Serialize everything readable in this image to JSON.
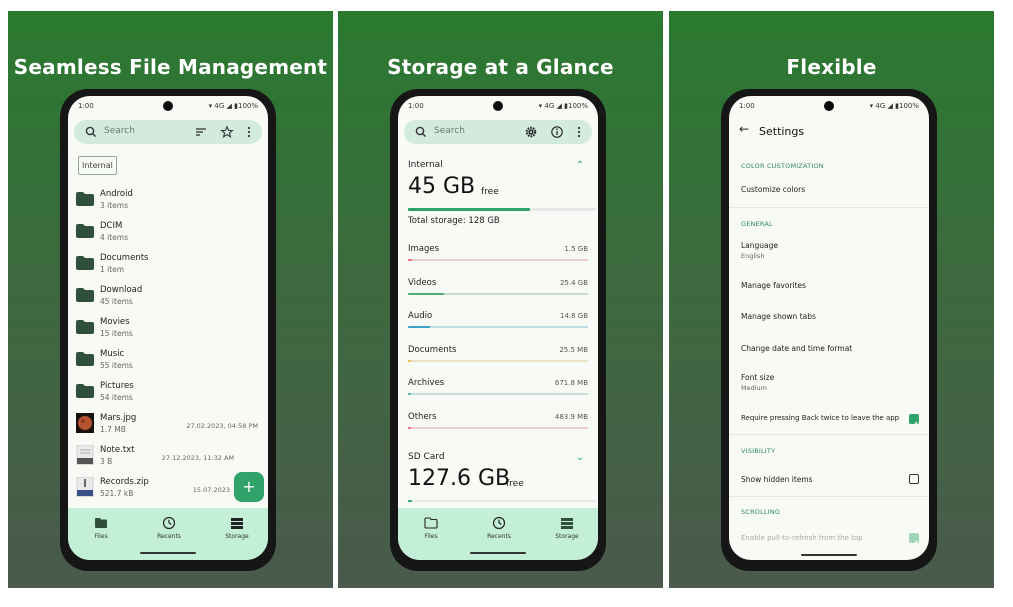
{
  "status": {
    "time": "1:00",
    "battery": "100%",
    "network": "4G"
  },
  "panels": [
    {
      "title": "Seamless File Management"
    },
    {
      "title": "Storage at a Glance"
    },
    {
      "title": "Flexible"
    }
  ],
  "files_screen": {
    "search_placeholder": "Search",
    "location_chip": "Internal",
    "items": [
      {
        "name": "Android",
        "sub": "3 items",
        "date": ""
      },
      {
        "name": "DCIM",
        "sub": "4 items",
        "date": ""
      },
      {
        "name": "Documents",
        "sub": "1 item",
        "date": ""
      },
      {
        "name": "Download",
        "sub": "45 items",
        "date": ""
      },
      {
        "name": "Movies",
        "sub": "15 items",
        "date": ""
      },
      {
        "name": "Music",
        "sub": "55 items",
        "date": ""
      },
      {
        "name": "Pictures",
        "sub": "54 items",
        "date": ""
      },
      {
        "name": "Mars.jpg",
        "sub": "1.7 MB",
        "date": "27.02.2023, 04:58 PM"
      },
      {
        "name": "Note.txt",
        "sub": "3 B",
        "date": "27.12.2023, 11:32 AM"
      },
      {
        "name": "Records.zip",
        "sub": "521.7 kB",
        "date": "15.07.2023"
      }
    ],
    "fab_label": "+"
  },
  "nav": {
    "files": "Files",
    "recents": "Recents",
    "storage": "Storage"
  },
  "storage_screen": {
    "search_placeholder": "Search",
    "internal_label": "Internal",
    "internal_free_value": "45 GB",
    "free_word": "free",
    "total_storage": "Total storage: 128 GB",
    "internal_used_fraction": 0.65,
    "categories": [
      {
        "name": "Images",
        "size": "1.5 GB",
        "color": "#e86b78",
        "fraction": 0.02
      },
      {
        "name": "Videos",
        "size": "25.4 GB",
        "color": "#4fae6d",
        "fraction": 0.2
      },
      {
        "name": "Audio",
        "size": "14.8 GB",
        "color": "#3ba3c8",
        "fraction": 0.12
      },
      {
        "name": "Documents",
        "size": "25.5 MB",
        "color": "#e8c14a",
        "fraction": 0.01
      },
      {
        "name": "Archives",
        "size": "671.8 MB",
        "color": "#4fb3a6",
        "fraction": 0.01
      },
      {
        "name": "Others",
        "size": "483.9 MB",
        "color": "#e86b78",
        "fraction": 0.01
      }
    ],
    "sdcard_label": "SD Card",
    "sdcard_free_value": "127.6 GB"
  },
  "settings_screen": {
    "title": "Settings",
    "sections": {
      "color": "COLOR CUSTOMIZATION",
      "general": "GENERAL",
      "visibility": "VISIBILITY",
      "scrolling": "SCROLLING"
    },
    "customize_colors": "Customize colors",
    "language": "Language",
    "language_value": "English",
    "manage_favorites": "Manage favorites",
    "manage_tabs": "Manage shown tabs",
    "date_format": "Change date and time format",
    "font_size": "Font size",
    "font_size_value": "Medium",
    "require_back": "Require pressing Back twice to leave the app",
    "require_back_checked": true,
    "show_hidden": "Show hidden items",
    "show_hidden_checked": false,
    "pull_to_refresh": "Enable pull-to-refresh from the top",
    "accent_color": "#2fa36a"
  }
}
